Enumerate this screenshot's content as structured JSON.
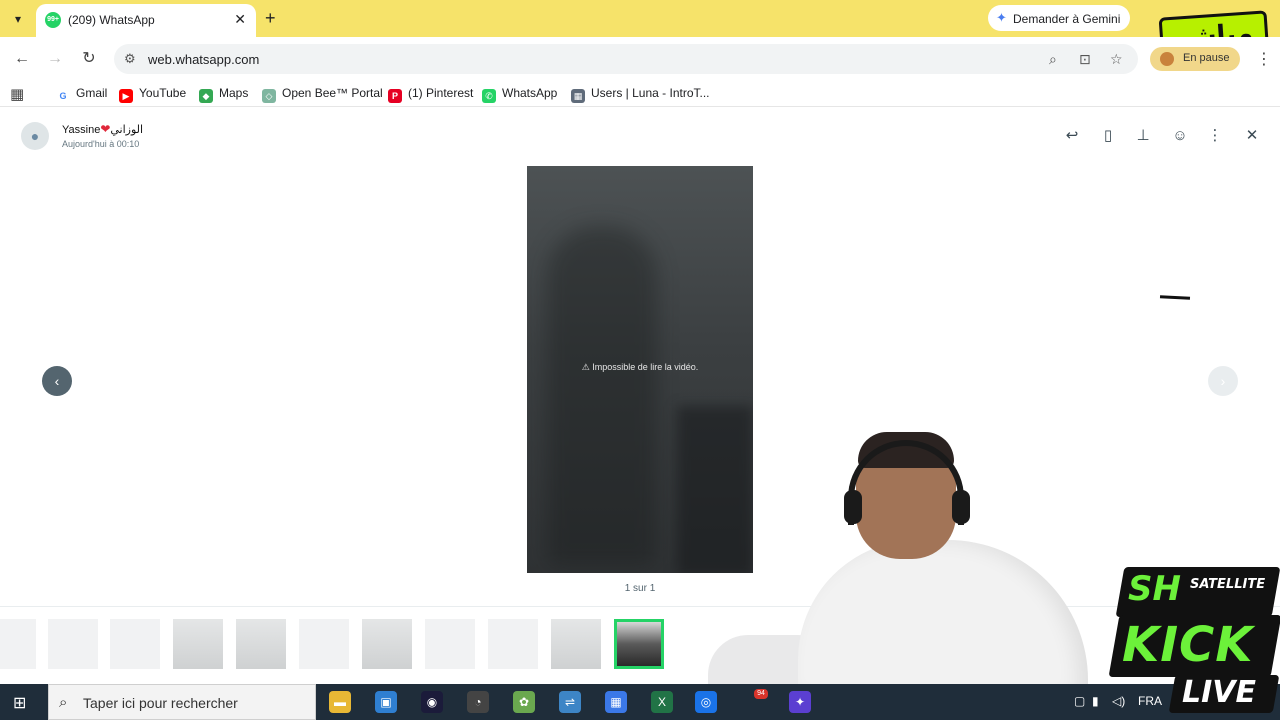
{
  "browser": {
    "tab_title": "(209) WhatsApp",
    "tab_badge": "99+",
    "new_tab_icon": "plus-icon",
    "gemini_label": "Demander à Gemini",
    "url": "web.whatsapp.com",
    "pause_label": "En pause",
    "live_badge_text": "مباشر"
  },
  "bookmarks": [
    {
      "label": "Gmail",
      "icon": "G",
      "color": "#ffffff"
    },
    {
      "label": "YouTube",
      "icon": "▶",
      "color": "#ff0000"
    },
    {
      "label": "Maps",
      "icon": "◆",
      "color": "#34a853"
    },
    {
      "label": "Open Bee™ Portal",
      "icon": "◇",
      "color": "#7fb6a0"
    },
    {
      "label": "(1) Pinterest",
      "icon": "P",
      "color": "#e60023"
    },
    {
      "label": "WhatsApp",
      "icon": "✆",
      "color": "#25d366"
    },
    {
      "label": "Users | Luna - IntroT...",
      "icon": "▦",
      "color": "#5f6b7a"
    }
  ],
  "viewer": {
    "sender_name": "Yassine",
    "sender_suffix": "الوزاني",
    "sent_time": "Aujourd'hui à 00:10",
    "video_error": "⚠ Impossible de lire la vidéo.",
    "page_counter": "1 sur 1",
    "header_icons": [
      "reply-icon",
      "bookmark-icon",
      "pin-icon",
      "emoji-icon",
      "menu-icon",
      "close-icon"
    ]
  },
  "thumbnails": {
    "count": 11,
    "active_index": 10
  },
  "taskbar": {
    "search_placeholder": "Taper ici pour rechercher",
    "language": "FRA",
    "badge_count": "94"
  },
  "overlay": {
    "kick_top": "SH",
    "kick_sat": "SATELLITE",
    "kick_main": "KICK",
    "kick_live": "LIVE"
  }
}
